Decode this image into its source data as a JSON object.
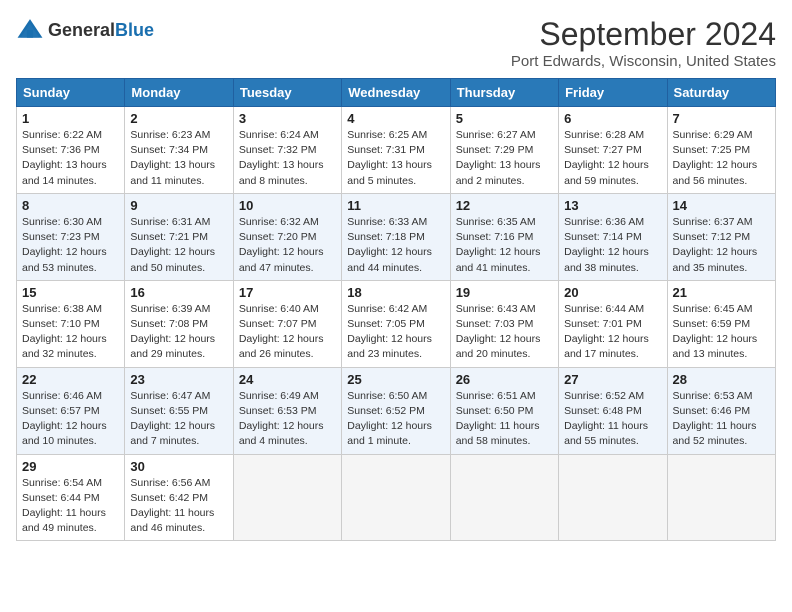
{
  "header": {
    "logo_general": "General",
    "logo_blue": "Blue",
    "month": "September 2024",
    "location": "Port Edwards, Wisconsin, United States"
  },
  "days_of_week": [
    "Sunday",
    "Monday",
    "Tuesday",
    "Wednesday",
    "Thursday",
    "Friday",
    "Saturday"
  ],
  "weeks": [
    [
      {
        "day": "1",
        "sunrise": "6:22 AM",
        "sunset": "7:36 PM",
        "daylight": "13 hours and 14 minutes."
      },
      {
        "day": "2",
        "sunrise": "6:23 AM",
        "sunset": "7:34 PM",
        "daylight": "13 hours and 11 minutes."
      },
      {
        "day": "3",
        "sunrise": "6:24 AM",
        "sunset": "7:32 PM",
        "daylight": "13 hours and 8 minutes."
      },
      {
        "day": "4",
        "sunrise": "6:25 AM",
        "sunset": "7:31 PM",
        "daylight": "13 hours and 5 minutes."
      },
      {
        "day": "5",
        "sunrise": "6:27 AM",
        "sunset": "7:29 PM",
        "daylight": "13 hours and 2 minutes."
      },
      {
        "day": "6",
        "sunrise": "6:28 AM",
        "sunset": "7:27 PM",
        "daylight": "12 hours and 59 minutes."
      },
      {
        "day": "7",
        "sunrise": "6:29 AM",
        "sunset": "7:25 PM",
        "daylight": "12 hours and 56 minutes."
      }
    ],
    [
      {
        "day": "8",
        "sunrise": "6:30 AM",
        "sunset": "7:23 PM",
        "daylight": "12 hours and 53 minutes."
      },
      {
        "day": "9",
        "sunrise": "6:31 AM",
        "sunset": "7:21 PM",
        "daylight": "12 hours and 50 minutes."
      },
      {
        "day": "10",
        "sunrise": "6:32 AM",
        "sunset": "7:20 PM",
        "daylight": "12 hours and 47 minutes."
      },
      {
        "day": "11",
        "sunrise": "6:33 AM",
        "sunset": "7:18 PM",
        "daylight": "12 hours and 44 minutes."
      },
      {
        "day": "12",
        "sunrise": "6:35 AM",
        "sunset": "7:16 PM",
        "daylight": "12 hours and 41 minutes."
      },
      {
        "day": "13",
        "sunrise": "6:36 AM",
        "sunset": "7:14 PM",
        "daylight": "12 hours and 38 minutes."
      },
      {
        "day": "14",
        "sunrise": "6:37 AM",
        "sunset": "7:12 PM",
        "daylight": "12 hours and 35 minutes."
      }
    ],
    [
      {
        "day": "15",
        "sunrise": "6:38 AM",
        "sunset": "7:10 PM",
        "daylight": "12 hours and 32 minutes."
      },
      {
        "day": "16",
        "sunrise": "6:39 AM",
        "sunset": "7:08 PM",
        "daylight": "12 hours and 29 minutes."
      },
      {
        "day": "17",
        "sunrise": "6:40 AM",
        "sunset": "7:07 PM",
        "daylight": "12 hours and 26 minutes."
      },
      {
        "day": "18",
        "sunrise": "6:42 AM",
        "sunset": "7:05 PM",
        "daylight": "12 hours and 23 minutes."
      },
      {
        "day": "19",
        "sunrise": "6:43 AM",
        "sunset": "7:03 PM",
        "daylight": "12 hours and 20 minutes."
      },
      {
        "day": "20",
        "sunrise": "6:44 AM",
        "sunset": "7:01 PM",
        "daylight": "12 hours and 17 minutes."
      },
      {
        "day": "21",
        "sunrise": "6:45 AM",
        "sunset": "6:59 PM",
        "daylight": "12 hours and 13 minutes."
      }
    ],
    [
      {
        "day": "22",
        "sunrise": "6:46 AM",
        "sunset": "6:57 PM",
        "daylight": "12 hours and 10 minutes."
      },
      {
        "day": "23",
        "sunrise": "6:47 AM",
        "sunset": "6:55 PM",
        "daylight": "12 hours and 7 minutes."
      },
      {
        "day": "24",
        "sunrise": "6:49 AM",
        "sunset": "6:53 PM",
        "daylight": "12 hours and 4 minutes."
      },
      {
        "day": "25",
        "sunrise": "6:50 AM",
        "sunset": "6:52 PM",
        "daylight": "12 hours and 1 minute."
      },
      {
        "day": "26",
        "sunrise": "6:51 AM",
        "sunset": "6:50 PM",
        "daylight": "11 hours and 58 minutes."
      },
      {
        "day": "27",
        "sunrise": "6:52 AM",
        "sunset": "6:48 PM",
        "daylight": "11 hours and 55 minutes."
      },
      {
        "day": "28",
        "sunrise": "6:53 AM",
        "sunset": "6:46 PM",
        "daylight": "11 hours and 52 minutes."
      }
    ],
    [
      {
        "day": "29",
        "sunrise": "6:54 AM",
        "sunset": "6:44 PM",
        "daylight": "11 hours and 49 minutes."
      },
      {
        "day": "30",
        "sunrise": "6:56 AM",
        "sunset": "6:42 PM",
        "daylight": "11 hours and 46 minutes."
      },
      null,
      null,
      null,
      null,
      null
    ]
  ]
}
